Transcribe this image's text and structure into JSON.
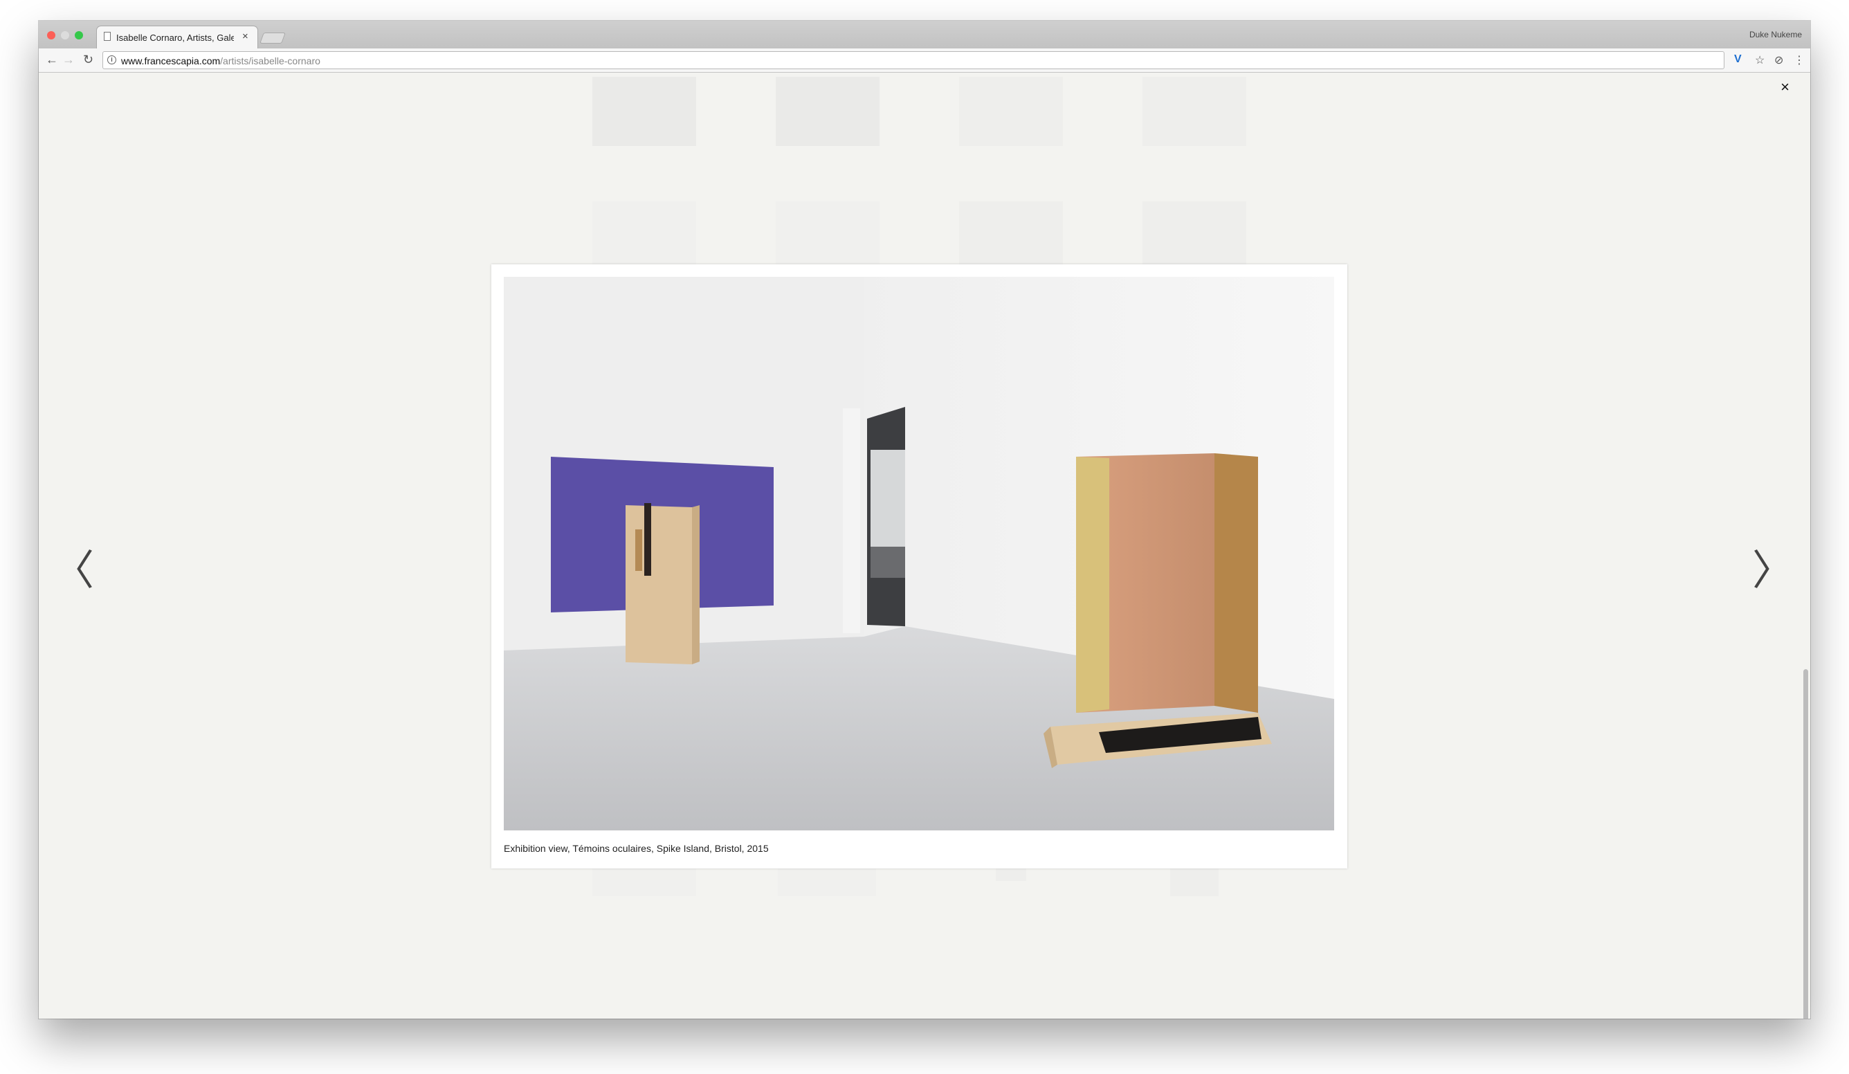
{
  "browser": {
    "tab_title": "Isabelle Cornaro, Artists, Galerie",
    "tab_close": "×",
    "profile_name": "Duke Nukeme",
    "url_host": "www.francescapia.com",
    "url_path": "/artists/isabelle-cornaro",
    "nav": {
      "back": "←",
      "forward": "→",
      "reload": "↻"
    },
    "extensions": {
      "v": "V",
      "star": "☆",
      "extra": "⊘",
      "menu": "⋮"
    },
    "info_icon": "i"
  },
  "lightbox": {
    "close_label": "×",
    "prev_label": "〈",
    "next_label": "〉",
    "caption": "Exhibition view, Témoins oculaires, Spike Island, Bristol, 2015"
  }
}
